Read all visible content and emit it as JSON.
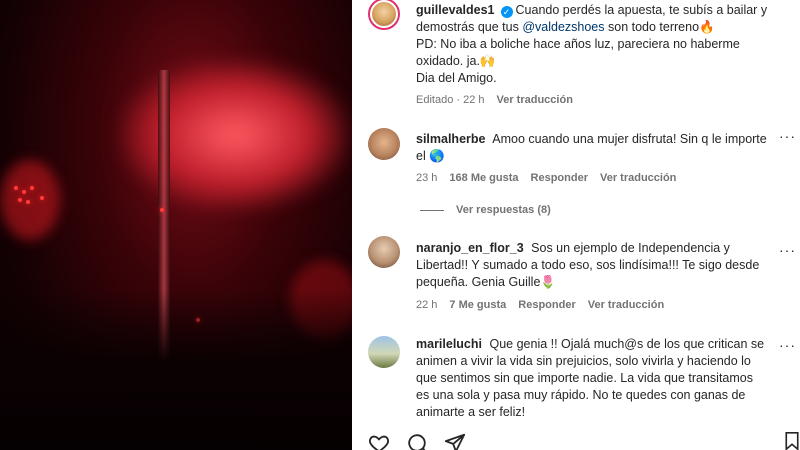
{
  "post": {
    "username": "guillevaldes1",
    "caption_line1": "Cuando perdés la apuesta, te subís a bailar y",
    "caption_line2_pre": "demostrás que tus",
    "caption_mention": "@valdezshoes",
    "caption_line2_post": "son todo terreno🔥",
    "caption_line3": "PD: No iba a boliche hace años luz, pareciera no haberme",
    "caption_line4": "oxidado. ja.🙌",
    "caption_line5": "Dia del Amigo.",
    "meta_edited": "Editado · 22 h",
    "meta_translate": "Ver traducción"
  },
  "comments": [
    {
      "username": "silmalherbe",
      "text_line1": "Amoo cuando una mujer disfruta! Sin q le importe",
      "text_line2": "el 🌎",
      "time": "23 h",
      "likes": "168 Me gusta",
      "reply": "Responder",
      "translate": "Ver traducción"
    },
    {
      "username": "naranjo_en_flor_3",
      "text_line1": "Sos un ejemplo de Independencia y",
      "text_line2": "Libertad!! Y sumado a todo eso, sos lindísima!!! Te sigo desde",
      "text_line3": "pequeña. Genia Guille🌷",
      "time": "22 h",
      "likes": "7 Me gusta",
      "reply": "Responder",
      "translate": "Ver traducción"
    },
    {
      "username": "marileluchi",
      "text_line1": "Que genia !! Ojalá much@s de los que critican se",
      "text_line2": "animen a vivir la vida sin prejuicios, solo vivirla y haciendo lo",
      "text_line3": "que sentimos sin que importe nadie. La vida que transitamos",
      "text_line4": "es una sola y pasa muy rápido. No te quedes con ganas de",
      "text_line5": "animarte a ser feliz!"
    }
  ],
  "view_replies": "Ver respuestas (8)",
  "icons": {
    "verified": "verified-badge-icon",
    "more": "more-options-icon",
    "like": "heart-icon",
    "comment": "comment-icon",
    "share": "share-icon",
    "save": "bookmark-icon"
  },
  "colors": {
    "mention": "#00376b",
    "verified": "#0095f6",
    "meta": "#737373"
  }
}
